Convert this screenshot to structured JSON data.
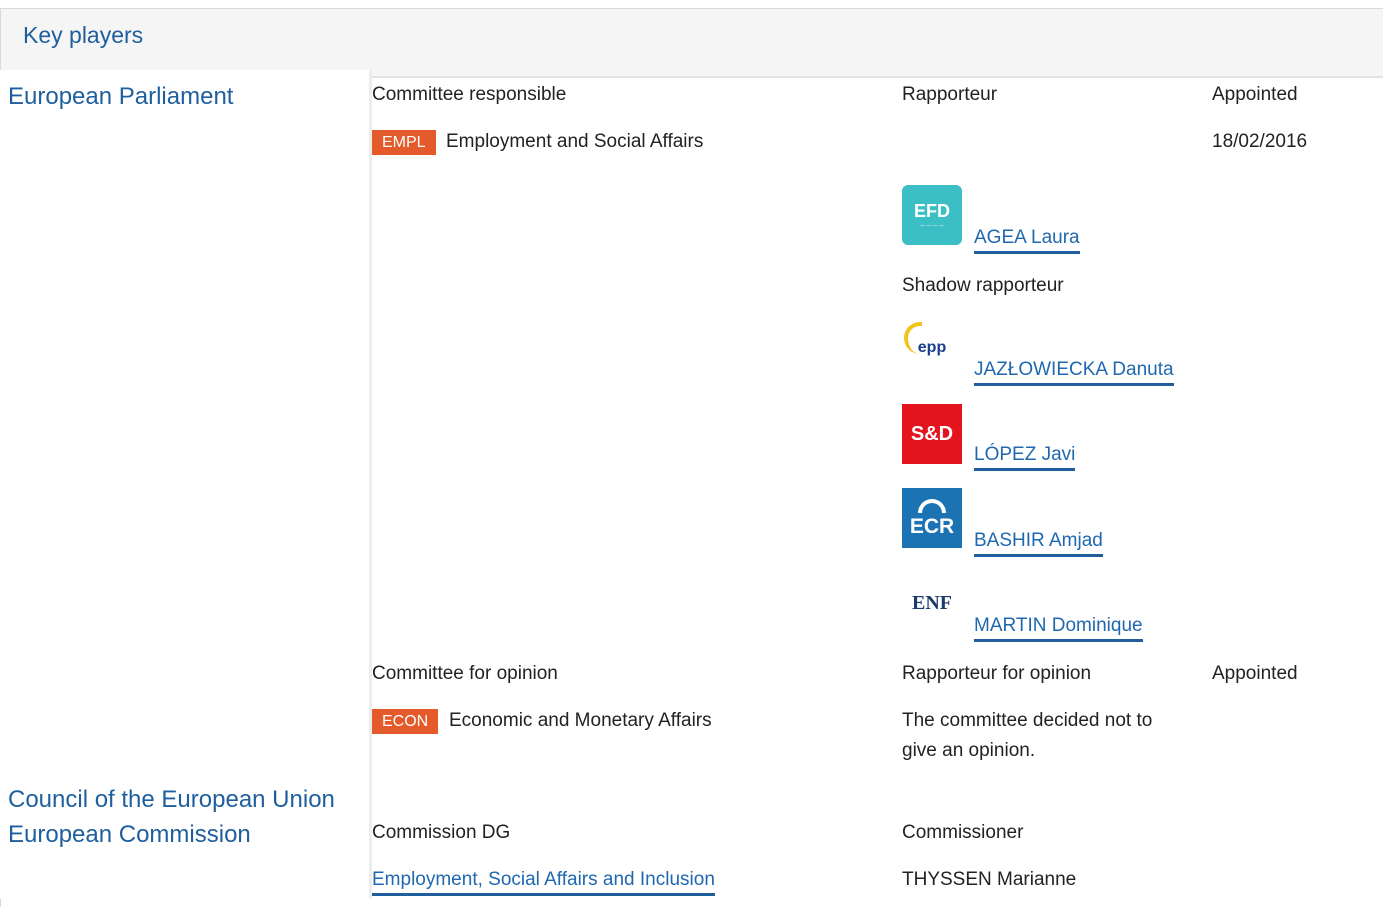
{
  "panel": {
    "title": "Key players"
  },
  "institutions": {
    "parliament": "European Parliament",
    "council": "Council of the European Union",
    "commission": "European Commission"
  },
  "responsible": {
    "committee_header": "Committee responsible",
    "rapporteur_header": "Rapporteur",
    "appointed_header": "Appointed",
    "committee_code": "EMPL",
    "committee_name": "Employment and Social Affairs",
    "appointed_date": "18/02/2016",
    "rapporteur": {
      "name": "AGEA Laura",
      "logo_text": "EFD",
      "logo_icon": "efdd-group-logo"
    },
    "shadow_header": "Shadow rapporteur",
    "shadows": [
      {
        "name": "JAZŁOWIECKA Danuta",
        "logo_text": "epp",
        "logo_icon": "epp-group-logo"
      },
      {
        "name": "LÓPEZ Javi",
        "logo_text": "S&D",
        "logo_icon": "sd-group-logo"
      },
      {
        "name": "BASHIR Amjad",
        "logo_text": "ECR",
        "logo_icon": "ecr-group-logo"
      },
      {
        "name": "MARTIN Dominique",
        "logo_text": "ENF",
        "logo_icon": "enf-group-logo"
      }
    ]
  },
  "opinion": {
    "committee_header": "Committee for opinion",
    "rapporteur_header": "Rapporteur for opinion",
    "appointed_header": "Appointed",
    "committee_code": "ECON",
    "committee_name": "Economic and Monetary Affairs",
    "note_line1": "The committee decided not to",
    "note_line2": "give an opinion."
  },
  "commission": {
    "dg_header": "Commission DG",
    "commissioner_header": "Commissioner",
    "dg_name": "Employment, Social Affairs and Inclusion",
    "commissioner_name": "THYSSEN Marianne"
  },
  "colors": {
    "link": "#1f68b0",
    "heading": "#1f5f9e",
    "committee_tag": "#e45a2b"
  }
}
